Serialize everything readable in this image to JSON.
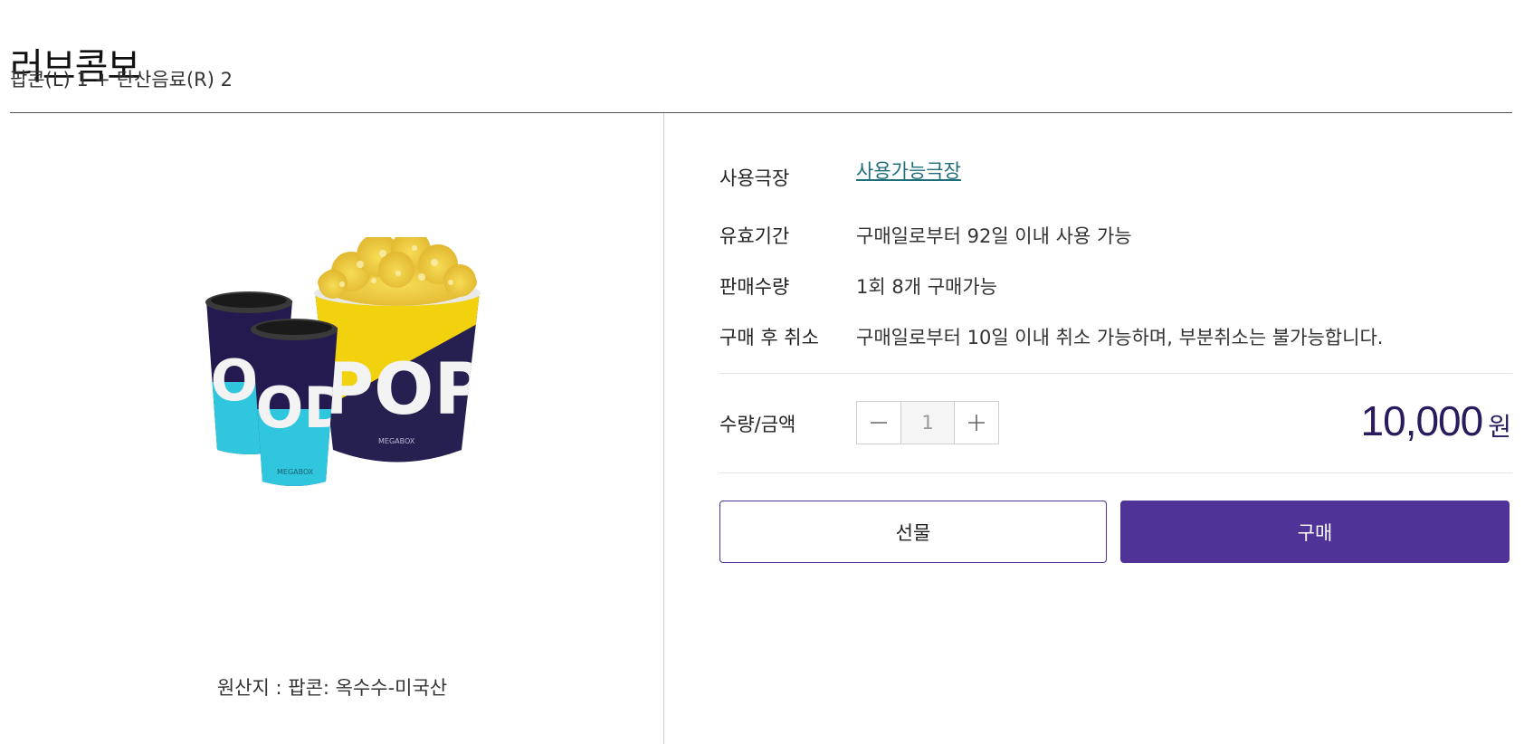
{
  "product": {
    "title": "러브콤보",
    "subtitle": "팝콘(L) 1 + 탄산음료(R) 2",
    "origin": "원산지 : 팝콘: 옥수수-미국산",
    "image_text": {
      "cup": "SODA",
      "bucket": "POPCORN",
      "brand": "MEGABOX"
    }
  },
  "info": {
    "theater_label": "사용극장",
    "theater_link": "사용가능극장",
    "validity_label": "유효기간",
    "validity_value": "구매일로부터 92일 이내 사용 가능",
    "sale_qty_label": "판매수량",
    "sale_qty_value": "1회 8개 구매가능",
    "cancel_label": "구매 후 취소",
    "cancel_value": "구매일로부터 10일 이내 취소 가능하며, 부분취소는 불가능합니다."
  },
  "purchase": {
    "qty_label": "수량/금액",
    "quantity": "1",
    "price": "10,000",
    "currency": "원",
    "gift_label": "선물",
    "buy_label": "구매"
  },
  "colors": {
    "accent": "#503396",
    "price": "#2a1a5e",
    "link": "#1e6e7a"
  }
}
